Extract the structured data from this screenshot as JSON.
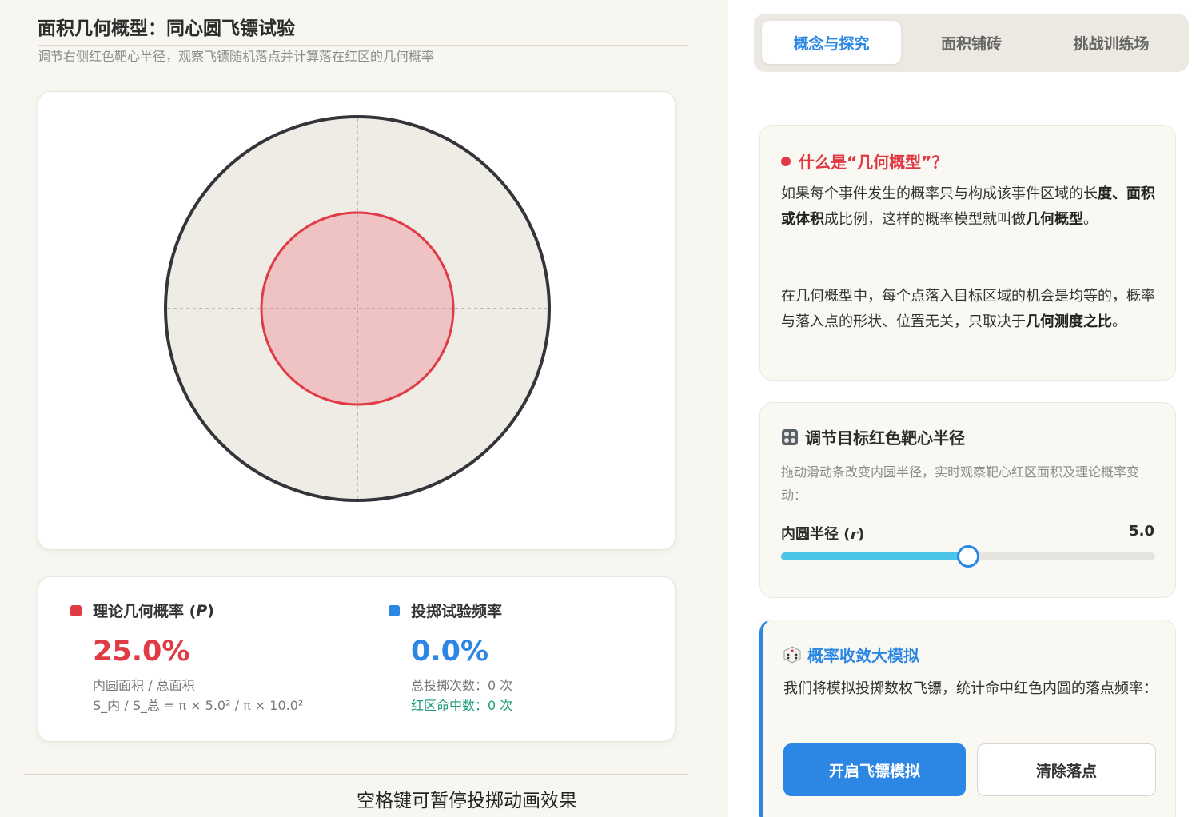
{
  "left": {
    "title": "面积几何概型：同心圆飞镖试验",
    "subtitle": "调节右侧红色靶心半径，观察飞镖随机落点并计算落在红区的几何概率",
    "target": {
      "outer_radius": 10.0,
      "inner_radius": 5.0,
      "colors": {
        "outer_fill": "#efebe5",
        "outer_stroke": "#33353b",
        "inner_fill": "#efc3c3",
        "inner_stroke": "#e03a45",
        "guides": "#8a8a8a"
      }
    },
    "stats": {
      "theory": {
        "label_pre": "理论几何概率 (",
        "label_var": "P",
        "label_post": ")",
        "value": "25.0%",
        "line1": "内圆面积 / 总面积",
        "line2": "S_内 / S_总 = π × 5.0² / π × 10.0²"
      },
      "trial": {
        "label": "投掷试验频率",
        "value": "0.0%",
        "line1": "总投掷次数：0 次",
        "line2": "红区命中数：0 次"
      }
    },
    "hint": "空格键可暂停投掷动画效果"
  },
  "tabs": [
    {
      "label": "概念与探究",
      "active": true
    },
    {
      "label": "面积铺砖",
      "active": false
    },
    {
      "label": "挑战训练场",
      "active": false
    }
  ],
  "concept": {
    "title": "什么是“几何概型”？",
    "p1_a": "如果每个事件发生的概率只与构成该事件区域的长",
    "p1_b_bold": "度、面积或体积",
    "p1_c": "成比例，这样的概率模型就叫做",
    "p1_d_bold": "几何",
    "p1_e_bold": "概型",
    "p1_f": "。",
    "p2_a": "在几何概型中，每个点落入目标区域的机会是均等的，概率与落入点的形状、位置无关，只取决于",
    "p2_b_bold": "几何测度之比",
    "p2_c": "。"
  },
  "slider_card": {
    "title": "调节目标红色靶心半径",
    "desc": "拖动滑动条改变内圆半径，实时观察靶心红区面积及理论概率变动：",
    "label_pre": "内圆半径 (",
    "label_var": "r",
    "label_post": ")",
    "value": "5.0",
    "fraction": 0.5,
    "colors": {
      "fill": "#4cc3e8",
      "thumb_border": "#2b86e4"
    }
  },
  "sim_card": {
    "title": "概率收敛大模拟",
    "desc": "我们将模拟投掷数枚飞镖，统计命中红色内圆的落点频率：",
    "start_button": "开启飞镖模拟",
    "clear_button": "清除落点"
  }
}
